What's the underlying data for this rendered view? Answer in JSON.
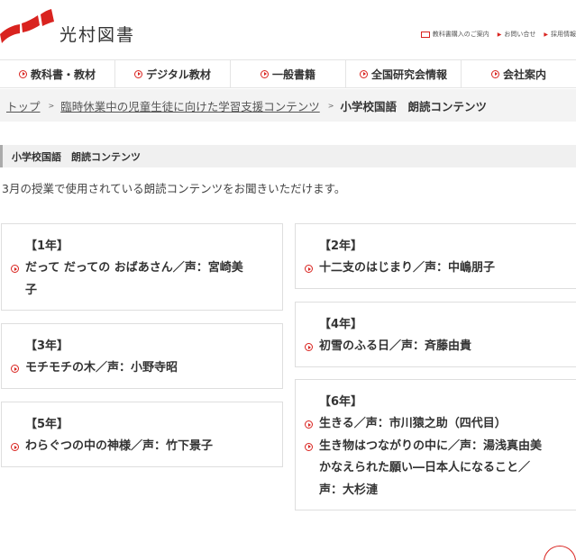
{
  "header": {
    "site_name": "光村図書",
    "logo_icon": "mitsumura-logo-mark",
    "util_links": [
      "教科書購入のご案内",
      "お問い合せ",
      "採用情報"
    ],
    "accent_color": "#d9231f"
  },
  "nav": {
    "items": [
      "教科書・教材",
      "デジタル教材",
      "一般書籍",
      "全国研究会情報",
      "会社案内"
    ]
  },
  "breadcrumb": {
    "home": "トップ",
    "parent": "臨時休業中の児童生徒に向けた学習支援コンテンツ",
    "current": "小学校国語　朗読コンテンツ",
    "separator": ">"
  },
  "main": {
    "section_title": "小学校国語　朗読コンテンツ",
    "intro": "3月の授業で使用されている朗読コンテンツをお聞きいただけます。",
    "grades": [
      {
        "grade": "【1年】",
        "items": [
          "だって だっての おばあさん／声：宮崎美",
          "子"
        ]
      },
      {
        "grade": "【2年】",
        "items": [
          "十二支のはじまり／声：中嶋朋子"
        ]
      },
      {
        "grade": "【3年】",
        "items": [
          "モチモチの木／声：小野寺昭"
        ]
      },
      {
        "grade": "【4年】",
        "items": [
          "初雪のふる日／声：斉藤由貴"
        ]
      },
      {
        "grade": "【5年】",
        "items": [
          "わらぐつの中の神様／声：竹下景子"
        ]
      },
      {
        "grade": "【6年】",
        "items": [
          "生きる／声：市川猿之助（四代目）",
          "生き物はつながりの中に／声：湯浅真由美",
          "かなえられた願い―日本人になること／",
          "声：大杉漣"
        ]
      }
    ]
  }
}
